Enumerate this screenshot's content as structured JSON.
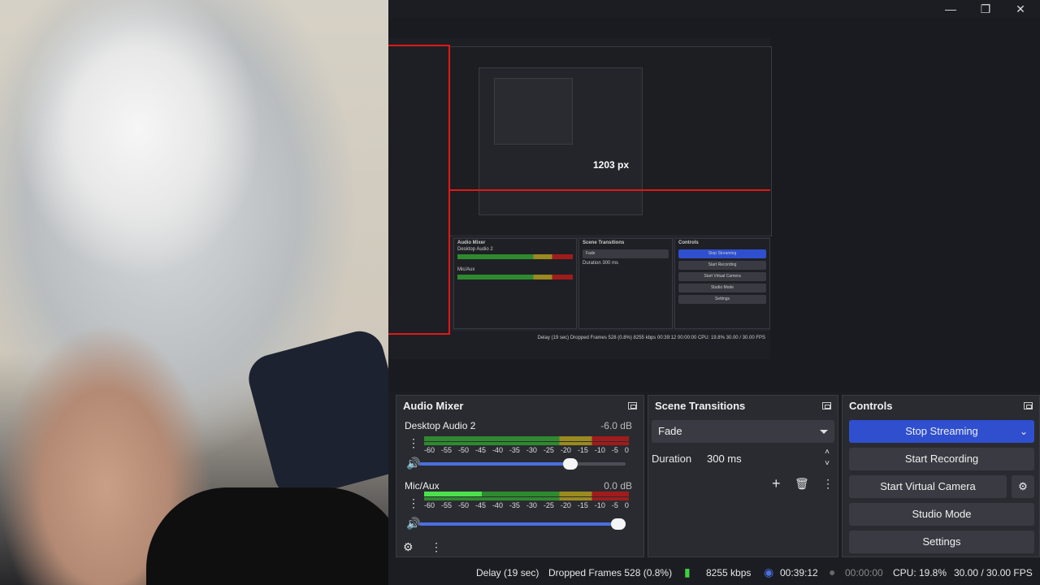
{
  "window": {
    "controls": [
      "minimize",
      "restore",
      "close"
    ]
  },
  "preview": {
    "measure_label": "1203 px",
    "mini": {
      "audio_mixer": "Audio Mixer",
      "desktop_audio": "Desktop Audio 2",
      "mic": "Mic/Aux",
      "scene_transitions": "Scene Transitions",
      "fade": "Fade",
      "duration_label": "Duration",
      "duration_value": "300 ms",
      "controls": "Controls",
      "stop_streaming": "Stop Streaming",
      "start_recording": "Start Recording",
      "start_virtual_camera": "Start Virtual Camera",
      "studio_mode": "Studio Mode",
      "settings": "Settings",
      "status": "Delay (19 sec)   Dropped Frames 528 (0.8%)   8255 kbps   00:39:12   00:00:00   CPU: 19.8%   30.00 / 30.00 FPS"
    }
  },
  "audio_mixer": {
    "title": "Audio Mixer",
    "tracks": [
      {
        "name": "Desktop Audio 2",
        "db": "-6.0 dB",
        "volume": 0.75,
        "level": 0.0
      },
      {
        "name": "Mic/Aux",
        "db": "0.0 dB",
        "volume": 1.0,
        "level": 0.28
      }
    ],
    "ticks": [
      "-60",
      "-55",
      "-50",
      "-45",
      "-40",
      "-35",
      "-30",
      "-25",
      "-20",
      "-15",
      "-10",
      "-5",
      "0"
    ]
  },
  "scene_transitions": {
    "title": "Scene Transitions",
    "transition": "Fade",
    "duration_label": "Duration",
    "duration_value": "300 ms"
  },
  "controls": {
    "title": "Controls",
    "stop_streaming": "Stop Streaming",
    "start_recording": "Start Recording",
    "start_virtual_camera": "Start Virtual Camera",
    "studio_mode": "Studio Mode",
    "settings": "Settings",
    "accent": "#2f4fcf"
  },
  "status": {
    "delay": "Delay (19 sec)",
    "dropped": "Dropped Frames 528 (0.8%)",
    "bitrate": "8255 kbps",
    "stream_time": "00:39:12",
    "record_time": "00:00:00",
    "cpu": "CPU: 19.8%",
    "fps": "30.00 / 30.00 FPS"
  }
}
